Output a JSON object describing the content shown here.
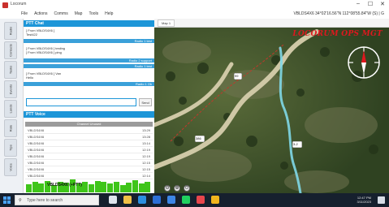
{
  "window": {
    "title": "Locorum",
    "controls": [
      "–",
      "☐",
      "✕"
    ]
  },
  "menu": {
    "items": [
      "File",
      "Actions",
      "Comms",
      "Map",
      "Tools",
      "Help"
    ],
    "coords": "VBLDS4X6  34°02'16.56\"N 112°08'55.84\"W  (S) | G"
  },
  "side_tabs": [
    "Radio",
    "Contacts",
    "Tasks",
    "Events",
    "Lands",
    "Rate",
    "Tips",
    "Voice"
  ],
  "ptt_chat": {
    "header": "PTT Chat",
    "messages": [
      {
        "lines": [
          "[ From VBLDS4X6 ]",
          "Test422"
        ]
      },
      {
        "lines": [
          "[ From VBLDS4X6 ] testing",
          "[ From VBLDS4X6 ] ping"
        ]
      },
      {
        "lines": [
          "[ From VBLDS4X6 ] Van",
          "Hello"
        ]
      }
    ],
    "bars": [
      "Radio 1 test",
      "Radio 2 support",
      "Radio 1 test",
      "Radio 1 Ok"
    ],
    "send_label": "Send",
    "input_placeholder": ""
  },
  "ptt_voice": {
    "header": "PTT Voice",
    "channel_label": "Channel Unused",
    "rows": [
      {
        "name": "VBLDS4X6",
        "time": "13:29"
      },
      {
        "name": "VBLDS4X6",
        "time": "13:28"
      },
      {
        "name": "VBLDS4X6",
        "time": "13:14"
      },
      {
        "name": "VBLDS4X6",
        "time": "12:19"
      },
      {
        "name": "VBLDS4X6",
        "time": "12:19"
      },
      {
        "name": "VBLDS4X6",
        "time": "12:15"
      },
      {
        "name": "VBLDS4X6",
        "time": "12:15"
      },
      {
        "name": "VBLDS4X6",
        "time": "12:14"
      }
    ],
    "meter_label": "VBLDS4X6 (+PTT)",
    "meter_levels": [
      0.55,
      0.7,
      0.6,
      0.8,
      0.5,
      0.75,
      0.65,
      0.9,
      0.6,
      0.7,
      0.55,
      0.8,
      0.7,
      0.6,
      0.75,
      0.5,
      0.65,
      0.85,
      0.6,
      0.7
    ]
  },
  "map": {
    "tab_label": "Map 1",
    "brand": "LOCORUM OPS MGT",
    "road_labels": [
      "99",
      "386",
      "3-2"
    ],
    "controls": [
      "⊖",
      "⊕",
      "⊙"
    ]
  },
  "taskbar": {
    "search_placeholder": "Type here to search",
    "tray_time": "12:47 PM",
    "tray_date": "3/11/2023",
    "icons": [
      {
        "name": "task-view-icon",
        "color": "#dfe5ee"
      },
      {
        "name": "explorer-icon",
        "color": "#f0c046"
      },
      {
        "name": "edge-icon",
        "color": "#2c8fe0"
      },
      {
        "name": "store-icon",
        "color": "#2d6fd6"
      },
      {
        "name": "mail-icon",
        "color": "#3d86e6"
      },
      {
        "name": "spotify-icon",
        "color": "#1fd15f"
      },
      {
        "name": "app-icon",
        "color": "#e8464c"
      },
      {
        "name": "chrome-icon",
        "color": "#f1b51d"
      }
    ]
  },
  "colors": {
    "accent": "#1d96d8",
    "brand_red": "#e0171e",
    "meter_green": "#3fc51a",
    "taskbar": "#16202e"
  }
}
